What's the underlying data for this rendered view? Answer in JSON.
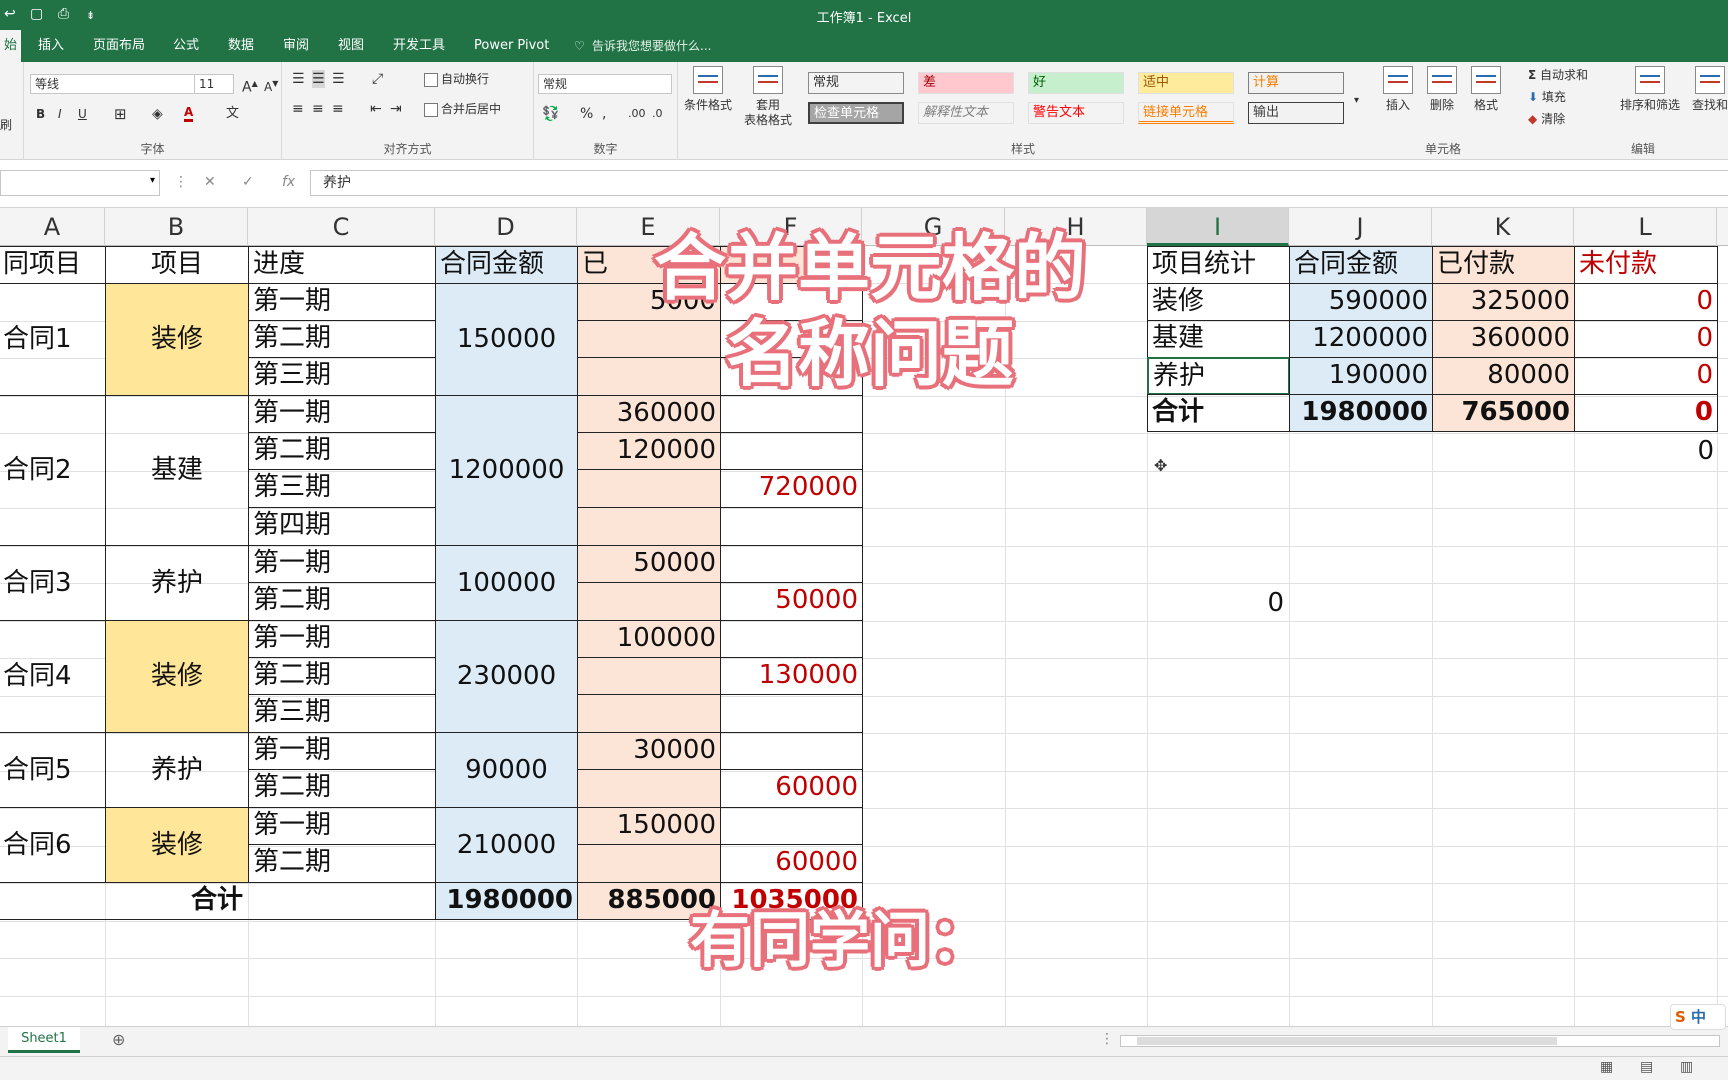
{
  "window": {
    "title": "工作簿1 - Excel"
  },
  "ribbon_tabs": [
    "始",
    "插入",
    "页面布局",
    "公式",
    "数据",
    "审阅",
    "视图",
    "开发工具",
    "Power Pivot"
  ],
  "tell_me": "告诉我您想要做什么...",
  "ribbon": {
    "paste_label": "刷",
    "font_name": "等线",
    "font_size": "11",
    "bold": "B",
    "italic": "I",
    "underline": "U",
    "group_font": "字体",
    "wrap_text": "自动换行",
    "merge_center": "合并后居中",
    "group_alignment": "对齐方式",
    "number_format": "常规",
    "percent": "%",
    "group_number": "数字",
    "conditional_format": "条件格式",
    "table_format_1": "套用",
    "table_format_2": "表格格式",
    "styles": [
      {
        "label": "常规",
        "bg": "#ffffff",
        "color": "#000000"
      },
      {
        "label": "差",
        "bg": "#ffc7ce",
        "color": "#9c0006"
      },
      {
        "label": "好",
        "bg": "#c6efce",
        "color": "#006100"
      },
      {
        "label": "适中",
        "bg": "#ffeb9c",
        "color": "#9c5700"
      },
      {
        "label": "计算",
        "bg": "#f2f2f2",
        "color": "#fa7d00"
      },
      {
        "label": "检查单元格",
        "bg": "#a5a5a5",
        "color": "#ffffff"
      },
      {
        "label": "解释性文本",
        "bg": "#ffffff",
        "color": "#7f7f7f"
      },
      {
        "label": "警告文本",
        "bg": "#ffffff",
        "color": "#ff0000"
      },
      {
        "label": "链接单元格",
        "bg": "#ffffff",
        "color": "#fa7d00"
      },
      {
        "label": "输出",
        "bg": "#f2f2f2",
        "color": "#3f3f3f"
      }
    ],
    "group_styles": "样式",
    "insert": "插入",
    "delete": "删除",
    "format": "格式",
    "group_cells": "单元格",
    "autosum": "自动求和",
    "fill": "填充",
    "clear": "清除",
    "sort_filter": "排序和筛选",
    "find_select": "查找和",
    "group_editing": "编辑"
  },
  "formula_bar": {
    "fx": "fx",
    "value": "养护"
  },
  "columns": [
    "A",
    "B",
    "C",
    "D",
    "E",
    "F",
    "G",
    "H",
    "I",
    "J",
    "K",
    "L"
  ],
  "main_table": {
    "headers": {
      "a": "同项目",
      "b": "项目",
      "c": "进度",
      "d": "合同金额",
      "e": "已",
      "f": ""
    },
    "contracts": [
      {
        "name": "合同1",
        "item": "装修",
        "amount": "150000",
        "phases": [
          "第一期",
          "第二期",
          "第三期"
        ],
        "paid": [
          "5000",
          "",
          ""
        ],
        "unpaid": [
          "",
          "",
          ""
        ]
      },
      {
        "name": "合同2",
        "item": "基建",
        "amount": "1200000",
        "phases": [
          "第一期",
          "第二期",
          "第三期",
          "第四期"
        ],
        "paid": [
          "360000",
          "120000",
          "",
          ""
        ],
        "unpaid": [
          "",
          "",
          "720000",
          ""
        ]
      },
      {
        "name": "合同3",
        "item": "养护",
        "amount": "100000",
        "phases": [
          "第一期",
          "第二期"
        ],
        "paid": [
          "50000",
          ""
        ],
        "unpaid": [
          "",
          "50000"
        ]
      },
      {
        "name": "合同4",
        "item": "装修",
        "amount": "230000",
        "phases": [
          "第一期",
          "第二期",
          "第三期"
        ],
        "paid": [
          "100000",
          "",
          ""
        ],
        "unpaid": [
          "",
          "130000",
          ""
        ]
      },
      {
        "name": "合同5",
        "item": "养护",
        "amount": "90000",
        "phases": [
          "第一期",
          "第二期"
        ],
        "paid": [
          "30000",
          ""
        ],
        "unpaid": [
          "",
          "60000"
        ]
      },
      {
        "name": "合同6",
        "item": "装修",
        "amount": "210000",
        "phases": [
          "第一期",
          "第二期"
        ],
        "paid": [
          "150000",
          ""
        ],
        "unpaid": [
          "",
          "60000"
        ]
      }
    ],
    "total": {
      "label": "合计",
      "amount": "1980000",
      "paid": "885000",
      "unpaid": "1035000"
    }
  },
  "summary_table": {
    "headers": [
      "项目统计",
      "合同金额",
      "已付款",
      "未付款"
    ],
    "rows": [
      {
        "item": "装修",
        "amount": "590000",
        "paid": "325000",
        "unpaid": "0"
      },
      {
        "item": "基建",
        "amount": "1200000",
        "paid": "360000",
        "unpaid": "0"
      },
      {
        "item": "养护",
        "amount": "190000",
        "paid": "80000",
        "unpaid": "0"
      },
      {
        "item": "合计",
        "amount": "1980000",
        "paid": "765000",
        "unpaid": "0"
      }
    ],
    "extra_l": "0",
    "extra_i": "0"
  },
  "overlay": {
    "title_line1": "合并单元格的",
    "title_line2": "名称问题",
    "caption": "有同学问："
  },
  "sheet_tab": "Sheet1",
  "ime": "中",
  "colors": {
    "excel_green": "#217346",
    "yellow": "#ffe699",
    "blue": "#ddebf7",
    "pink": "#fce4d6",
    "red": "#c00000",
    "overlay_outline": "#e8707a"
  }
}
